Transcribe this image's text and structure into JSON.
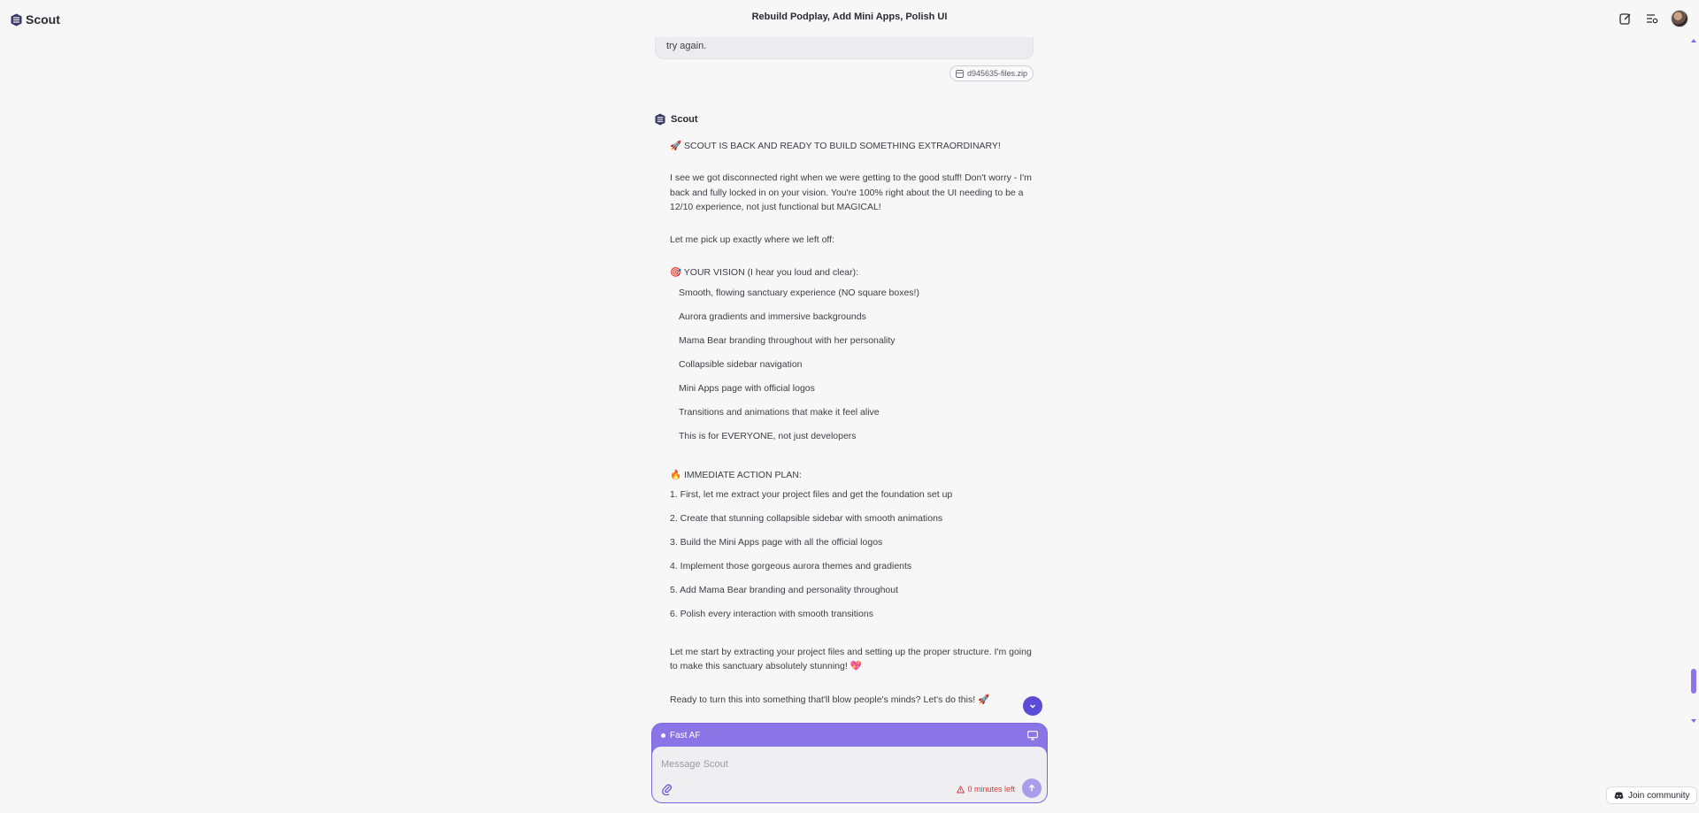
{
  "app": {
    "name": "Scout"
  },
  "header": {
    "title": "Rebuild Podplay, Add Mini Apps, Polish UI",
    "icons": [
      "new-chat-icon",
      "history-icon"
    ]
  },
  "conversation": {
    "user_message_tail": "try again.",
    "attachment": {
      "name": "d945635-files.zip",
      "icon": "archive-icon"
    },
    "assistant": {
      "name": "Scout",
      "headline": "🚀 SCOUT IS BACK AND READY TO BUILD SOMETHING EXTRAORDINARY!",
      "intro": "I see we got disconnected right when we were getting to the good stuff! Don't worry - I'm back and fully locked in on your vision. You're 100% right about the UI needing to be a 12/10 experience, not just functional but MAGICAL!",
      "pickup": "Let me pick up exactly where we left off:",
      "vision_heading": "🎯 YOUR VISION (I hear you loud and clear):",
      "vision_items": [
        "Smooth, flowing sanctuary experience (NO square boxes!)",
        "Aurora gradients and immersive backgrounds",
        "Mama Bear branding throughout with her personality",
        "Collapsible sidebar navigation",
        "Mini Apps page with official logos",
        "Transitions and animations that make it feel alive",
        "This is for EVERYONE, not just developers"
      ],
      "plan_heading": "🔥 IMMEDIATE ACTION PLAN:",
      "plan_items": [
        "1. First, let me extract your project files and get the foundation set up",
        "2. Create that stunning collapsible sidebar with smooth animations",
        "3. Build the Mini Apps page with all the official logos",
        "4. Implement those gorgeous aurora themes and gradients",
        "5. Add Mama Bear branding and personality throughout",
        "6. Polish every interaction with smooth transitions"
      ],
      "start": "Let me start by extracting your project files and setting up the proper structure. I'm going to make this sanctuary absolutely stunning! 💖",
      "closing": "Ready to turn this into something that'll blow people's minds? Let's do this! 🚀"
    }
  },
  "composer": {
    "mode_label": "Fast AF",
    "placeholder": "Message Scout",
    "time_left": "0 minutes left",
    "accent": "#8a74e6",
    "warning_color": "#d23c3c"
  },
  "footer": {
    "join_label": "Join community"
  }
}
